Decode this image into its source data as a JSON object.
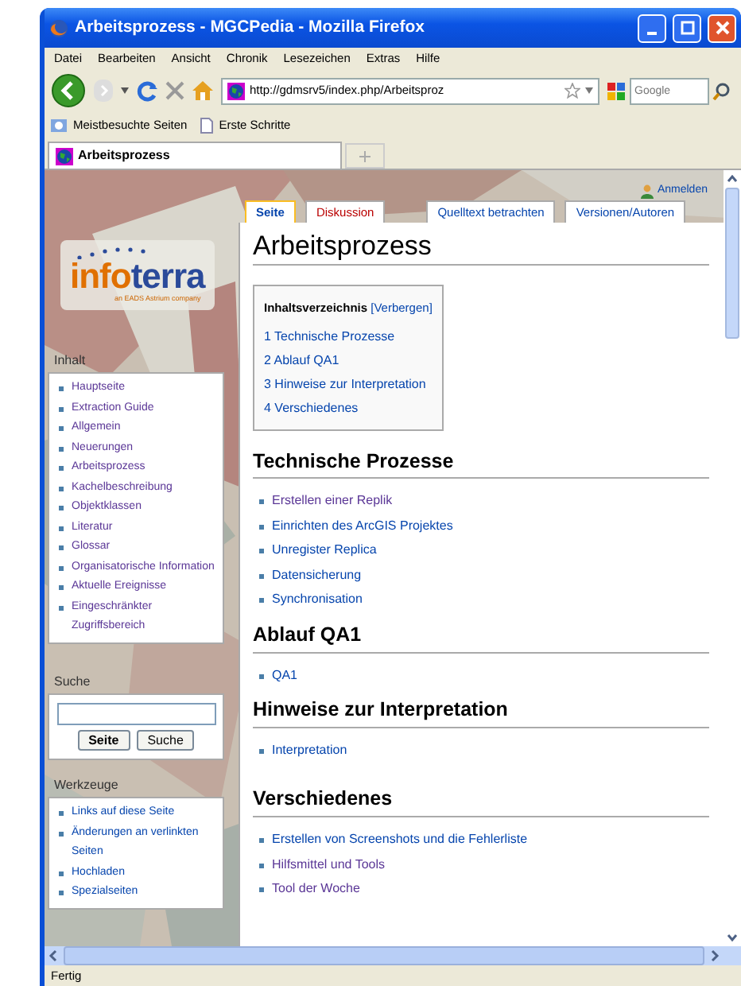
{
  "window": {
    "title": "Arbeitsprozess - MGCPedia - Mozilla Firefox"
  },
  "menu": [
    "Datei",
    "Bearbeiten",
    "Ansicht",
    "Chronik",
    "Lesezeichen",
    "Extras",
    "Hilfe"
  ],
  "address": {
    "value": "http://gdmsrv5/index.php/Arbeitsproz"
  },
  "web_search": {
    "placeholder": "Google"
  },
  "bookmarks": [
    "Meistbesuchte Seiten",
    "Erste Schritte"
  ],
  "browser_tabs": [
    {
      "label": "Arbeitsprozess",
      "selected": true
    }
  ],
  "personal": "Anmelden",
  "page_tabs": [
    {
      "label": "Seite",
      "selected": true,
      "missing": false
    },
    {
      "label": "Diskussion",
      "selected": false,
      "missing": true
    },
    {
      "label": "Quelltext betrachten",
      "selected": false,
      "missing": false
    },
    {
      "label": "Versionen/Autoren",
      "selected": false,
      "missing": false
    }
  ],
  "logo": {
    "part_1": "info",
    "part_2": "terra",
    "tagline": "an EADS Astrium company"
  },
  "sidebar": {
    "navigation": {
      "heading": "Inhalt",
      "items": [
        {
          "label": "Hauptseite",
          "visited": true
        },
        {
          "label": "Extraction Guide",
          "visited": true
        },
        {
          "label": "Allgemein",
          "visited": true
        },
        {
          "label": "Neuerungen",
          "visited": true
        },
        {
          "label": "Arbeitsprozess",
          "visited": true
        },
        {
          "label": "Kachelbeschreibung",
          "visited": true
        },
        {
          "label": "Objektklassen",
          "visited": true
        },
        {
          "label": "Literatur",
          "visited": true
        },
        {
          "label": "Glossar",
          "visited": true
        },
        {
          "label": "Organisatorische Information",
          "visited": true
        },
        {
          "label": "Aktuelle Ereignisse",
          "visited": true
        },
        {
          "label": "Eingeschränkter Zugriffsbereich",
          "visited": true
        }
      ]
    },
    "search": {
      "heading": "Suche",
      "buttons": [
        "Seite",
        "Suche"
      ]
    },
    "tools": {
      "heading": "Werkzeuge",
      "items": [
        {
          "label": "Links auf diese Seite",
          "visited": false
        },
        {
          "label": "Änderungen an verlinkten Seiten",
          "visited": false
        },
        {
          "label": "Hochladen",
          "visited": false
        },
        {
          "label": "Spezialseiten",
          "visited": false
        }
      ]
    }
  },
  "article": {
    "title": "Arbeitsprozess",
    "toc": {
      "title": "Inhaltsverzeichnis",
      "toggle": "[Verbergen]",
      "items": [
        {
          "number": "1",
          "text": "Technische Prozesse"
        },
        {
          "number": "2",
          "text": "Ablauf QA1"
        },
        {
          "number": "3",
          "text": "Hinweise zur Interpretation"
        },
        {
          "number": "4",
          "text": "Verschiedenes"
        }
      ]
    },
    "sections": [
      {
        "heading": "Technische Prozesse",
        "links": [
          {
            "label": "Erstellen einer Replik",
            "visited": true
          },
          {
            "label": "Einrichten des ArcGIS Projektes",
            "visited": false
          },
          {
            "label": "Unregister Replica",
            "visited": false
          },
          {
            "label": "Datensicherung",
            "visited": false
          },
          {
            "label": "Synchronisation",
            "visited": false
          }
        ]
      },
      {
        "heading": "Ablauf QA1",
        "links": [
          {
            "label": "QA1",
            "visited": false
          }
        ]
      },
      {
        "heading": "Hinweise zur Interpretation",
        "links": [
          {
            "label": "Interpretation",
            "visited": false
          }
        ]
      },
      {
        "heading": "Verschiedenes",
        "links": [
          {
            "label": "Erstellen von Screenshots und die Fehlerliste",
            "visited": false
          },
          {
            "label": "Hilfsmittel und Tools",
            "visited": true
          },
          {
            "label": "Tool der Woche",
            "visited": true
          }
        ]
      }
    ]
  },
  "status_bar": "Fertig"
}
